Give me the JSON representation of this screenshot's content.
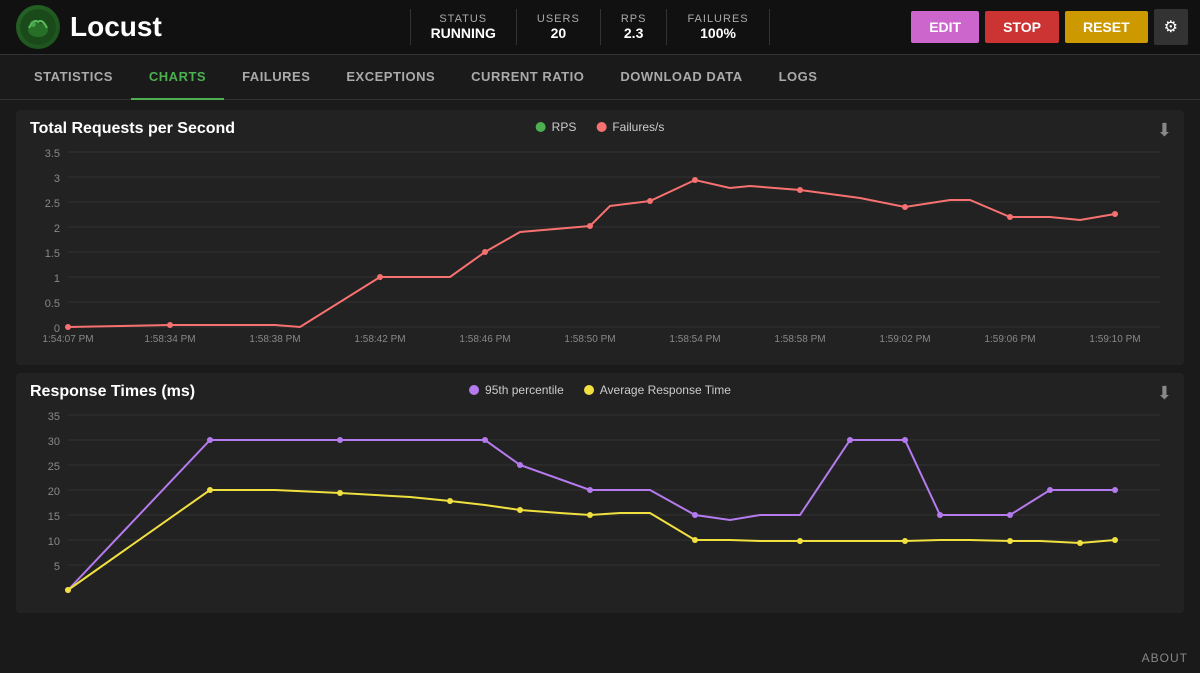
{
  "header": {
    "title": "Locust",
    "status": {
      "label": "STATUS",
      "value": "RUNNING"
    },
    "users": {
      "label": "USERS",
      "value": "20"
    },
    "rps": {
      "label": "RPS",
      "value": "2.3"
    },
    "failures": {
      "label": "FAILURES",
      "value": "100%"
    },
    "edit_label": "EDIT",
    "stop_label": "STOP",
    "reset_label": "RESET"
  },
  "nav": {
    "items": [
      {
        "label": "STATISTICS",
        "active": false
      },
      {
        "label": "CHARTS",
        "active": true
      },
      {
        "label": "FAILURES",
        "active": false
      },
      {
        "label": "EXCEPTIONS",
        "active": false
      },
      {
        "label": "CURRENT RATIO",
        "active": false
      },
      {
        "label": "DOWNLOAD DATA",
        "active": false
      },
      {
        "label": "LOGS",
        "active": false
      }
    ]
  },
  "chart1": {
    "title": "Total Requests per Second",
    "legend": [
      {
        "label": "RPS",
        "color": "#4caf50"
      },
      {
        "label": "Failures/s",
        "color": "#f87171"
      }
    ],
    "x_labels": [
      "1:54:07 PM",
      "1:58:34 PM",
      "1:58:38 PM",
      "1:58:42 PM",
      "1:58:46 PM",
      "1:58:50 PM",
      "1:58:54 PM",
      "1:58:58 PM",
      "1:59:02 PM",
      "1:59:06 PM",
      "1:59:10 PM"
    ],
    "y_labels": [
      "3.5",
      "3",
      "2.5",
      "2",
      "1.5",
      "1",
      "0.5",
      "0"
    ]
  },
  "chart2": {
    "title": "Response Times (ms)",
    "legend": [
      {
        "label": "95th percentile",
        "color": "#b57bee"
      },
      {
        "label": "Average Response Time",
        "color": "#f0e040"
      }
    ],
    "y_labels": [
      "35",
      "30",
      "25",
      "20",
      "15",
      "10",
      "5"
    ]
  },
  "about": "ABOUT"
}
